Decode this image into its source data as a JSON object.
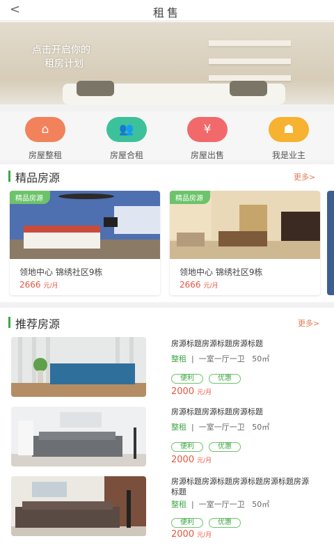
{
  "header": {
    "back": "<",
    "title": "租售"
  },
  "banner": {
    "line1": "点击开启你的",
    "line2": "租房计划"
  },
  "quick": [
    {
      "label": "房屋整租",
      "icon": "house-icon",
      "color": "#f2825c"
    },
    {
      "label": "房屋合租",
      "icon": "users-icon",
      "color": "#3cc19a"
    },
    {
      "label": "房屋出售",
      "icon": "ticket-icon",
      "color": "#f2696b"
    },
    {
      "label": "我是业主",
      "icon": "owner-icon",
      "color": "#f6b230"
    }
  ],
  "featured": {
    "title": "精品房源",
    "more": "更多>",
    "cards": [
      {
        "tag": "精品房源",
        "name": "领地中心  锦绣社区9栋",
        "price": "2666",
        "unit": "元/月"
      },
      {
        "tag": "精品房源",
        "name": "领地中心  锦绣社区9栋",
        "price": "2666",
        "unit": "元/月"
      }
    ]
  },
  "recommend": {
    "title": "推荐房源",
    "more": "更多>",
    "items": [
      {
        "title": "房源标题房源标题房源标题",
        "type": "整租",
        "sep": "|",
        "layout": "一室一厅一卫",
        "area": "50㎡",
        "tags": [
          "便利",
          "优惠"
        ],
        "price": "2000",
        "unit": "元/月"
      },
      {
        "title": "房源标题房源标题房源标题",
        "type": "整租",
        "sep": "|",
        "layout": "一室一厅一卫",
        "area": "50㎡",
        "tags": [
          "便利",
          "优惠"
        ],
        "price": "2000",
        "unit": "元/月"
      },
      {
        "title": "房源标题房源标题房源标题房源标题房源标题",
        "type": "整租",
        "sep": "|",
        "layout": "一室一厅一卫",
        "area": "50㎡",
        "tags": [
          "便利",
          "优惠"
        ],
        "price": "2000",
        "unit": "元/月"
      }
    ]
  }
}
